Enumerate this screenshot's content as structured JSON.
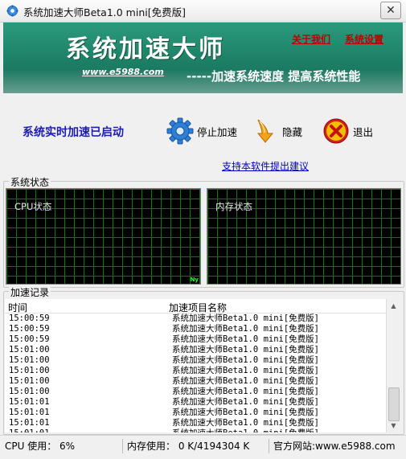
{
  "window": {
    "title": "系统加速大师Beta1.0  mini[免费版]",
    "close_glyph": "✕"
  },
  "banner": {
    "title": "系统加速大师",
    "url": "www.e5988.com",
    "slogan": "-----加速系统速度  提高系统性能",
    "links": {
      "about": "关于我们",
      "settings": "系统设置"
    }
  },
  "controls": {
    "status": "系统实时加速已启动",
    "stop_label": "停止加速",
    "hide_label": "隐藏",
    "exit_label": "退出",
    "feedback_link": "支持本软件提出建议"
  },
  "monitor": {
    "group_title": "系统状态",
    "cpu_label": "CPU状态",
    "memory_label": "内存状态",
    "cpu_tick": "Ny"
  },
  "log": {
    "group_title": "加速记录",
    "columns": {
      "time": "时间",
      "name": "加速项目名称"
    },
    "rows": [
      {
        "time": "15:00:59",
        "name": "系统加速大师Beta1.0  mini[免费版]"
      },
      {
        "time": "15:00:59",
        "name": "系统加速大师Beta1.0  mini[免费版]"
      },
      {
        "time": "15:00:59",
        "name": "系统加速大师Beta1.0  mini[免费版]"
      },
      {
        "time": "15:01:00",
        "name": "系统加速大师Beta1.0  mini[免费版]"
      },
      {
        "time": "15:01:00",
        "name": "系统加速大师Beta1.0  mini[免费版]"
      },
      {
        "time": "15:01:00",
        "name": "系统加速大师Beta1.0  mini[免费版]"
      },
      {
        "time": "15:01:00",
        "name": "系统加速大师Beta1.0  mini[免费版]"
      },
      {
        "time": "15:01:00",
        "name": "系统加速大师Beta1.0  mini[免费版]"
      },
      {
        "time": "15:01:01",
        "name": "系统加速大师Beta1.0  mini[免费版]"
      },
      {
        "time": "15:01:01",
        "name": "系统加速大师Beta1.0  mini[免费版]"
      },
      {
        "time": "15:01:01",
        "name": "系统加速大师Beta1.0  mini[免费版]"
      },
      {
        "time": "15:01:01",
        "name": "系统加速大师Beta1.0  mini[免费版]"
      }
    ]
  },
  "statusbar": {
    "cpu": "CPU 使用： 6%",
    "memory": "内存使用： 0 K/4194304 K",
    "site": "官方网站:www.e5988.com"
  },
  "colors": {
    "banner": "#1d7f66",
    "status_text": "#1c1cb4",
    "link_red": "#c00000",
    "grid": "#0b7a0b"
  },
  "icons": {
    "app": "gear-icon",
    "stop": "gear-icon",
    "hide": "down-arrow-icon",
    "exit": "close-circle-icon"
  }
}
